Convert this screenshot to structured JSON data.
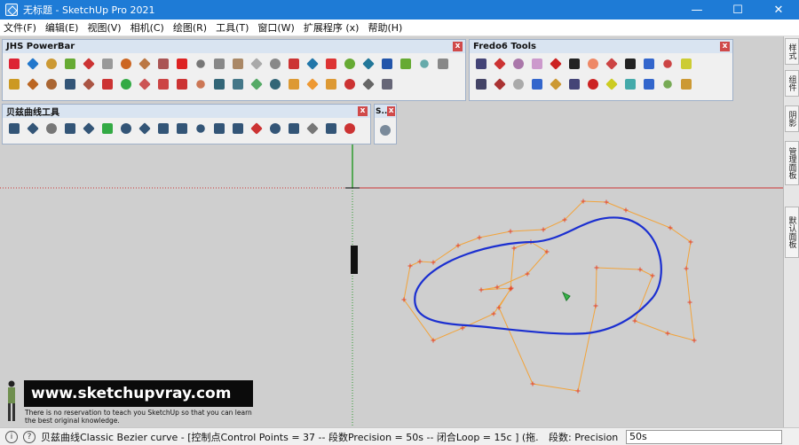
{
  "window": {
    "title": "无标题 - SketchUp Pro 2021",
    "controls": {
      "minimize": "—",
      "maximize": "☐",
      "close": "✕"
    }
  },
  "menu": [
    "文件(F)",
    "编辑(E)",
    "视图(V)",
    "相机(C)",
    "绘图(R)",
    "工具(T)",
    "窗口(W)",
    "扩展程序 (x)",
    "帮助(H)"
  ],
  "toolbars": {
    "jhs": {
      "title": "JHS PowerBar",
      "close": "x"
    },
    "bezier": {
      "title": "贝兹曲线工具",
      "close": "x"
    },
    "small": {
      "title": "S..",
      "close": "x"
    },
    "fredo": {
      "title": "Fredo6 Tools",
      "close": "x"
    }
  },
  "colors": {
    "curve": "#1b2fd0",
    "control_polygon": "#f2a33a",
    "control_point": "#e5482a",
    "axis_red": "#c33",
    "axis_green": "#2d9a2d",
    "title_bar": "#1e7bd6"
  },
  "tray_tabs": [
    "样式",
    "组件",
    "阴影",
    "管理面板",
    "默认面板"
  ],
  "watermark": {
    "banner": "www.sketchupvray.com",
    "line1": "There is no reservation to teach you SketchUp so that you can learn",
    "line2": "the best original knowledge."
  },
  "status": {
    "message": "贝兹曲线Classic Bezier curve - [控制点Control Points = 37  -- 段数Precision = 50s  -- 闭合Loop = 15c ]  (拖...",
    "vcb_label": "段数:  Precision",
    "vcb_value": "50s"
  }
}
